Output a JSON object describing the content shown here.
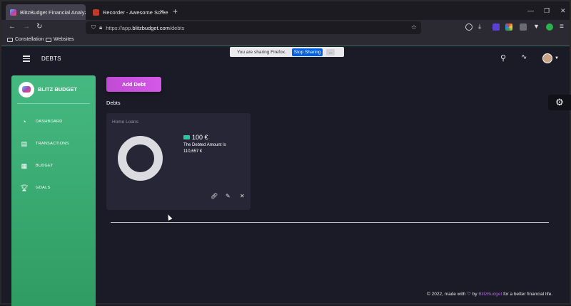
{
  "browser": {
    "tabs": [
      {
        "title": "BlitzBudget Financial Analyzer",
        "active": true
      },
      {
        "title": "Recorder - Awesome Screensh",
        "active": false
      }
    ],
    "url_prefix": "https://app.",
    "url_host": "blitzbudget.com",
    "url_path": "/debts",
    "bookmarks": [
      "Constellation",
      "Websites"
    ]
  },
  "sharing": {
    "message": "You are sharing Firefox.",
    "stop_label": "Stop Sharing",
    "more_label": "..."
  },
  "header": {
    "title": "DEBTS"
  },
  "sidebar": {
    "brand": "BLITZ BUDGET",
    "items": [
      {
        "label": "DASHBOARD",
        "icon": "dashboard-icon"
      },
      {
        "label": "TRANSACTIONS",
        "icon": "transactions-icon"
      },
      {
        "label": "BUDGET",
        "icon": "budget-icon"
      },
      {
        "label": "GOALS",
        "icon": "goals-icon"
      }
    ]
  },
  "main": {
    "add_button": "Add Debt",
    "section_title": "Debts",
    "card": {
      "title": "Home Loans",
      "amount": "100 €",
      "description": "The Debted Amount Is 110,657 €"
    }
  },
  "footer": {
    "prefix": "© 2022, made with ♡ by ",
    "brand": "BlitzBudget",
    "suffix": " for a better financial life."
  },
  "colors": {
    "sidebar": "#3aab72",
    "accent_button": "#c94fdf",
    "background": "#1b1b27",
    "card": "#262636"
  }
}
